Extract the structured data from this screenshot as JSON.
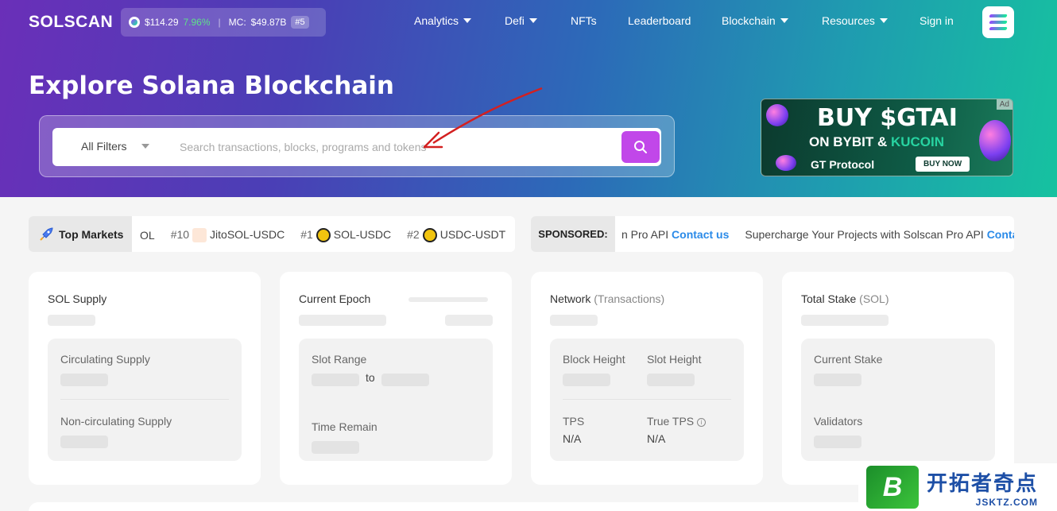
{
  "header": {
    "logo": "SOLSCAN",
    "price": "$114.29",
    "change": "7.96%",
    "mc_label": "MC:",
    "mc_value": "$49.87B",
    "rank": "#5",
    "nav": [
      {
        "label": "Analytics",
        "dropdown": true
      },
      {
        "label": "Defi",
        "dropdown": true
      },
      {
        "label": "NFTs",
        "dropdown": false
      },
      {
        "label": "Leaderboard",
        "dropdown": false
      },
      {
        "label": "Blockchain",
        "dropdown": true
      },
      {
        "label": "Resources",
        "dropdown": true
      },
      {
        "label": "Sign in",
        "dropdown": false
      }
    ]
  },
  "hero": {
    "title": "Explore Solana Blockchain",
    "filter_label": "All Filters",
    "search_placeholder": "Search transactions, blocks, programs and tokens"
  },
  "ad": {
    "line1": "BUY $GTAI",
    "line2a": "ON BYBIT &",
    "line2b": "KUCOIN",
    "line3": "GT Protocol",
    "cta": "BUY NOW",
    "tag": "Ad"
  },
  "ticker": {
    "title": "Top Markets",
    "items": [
      {
        "rank": "",
        "pair": "OL"
      },
      {
        "rank": "#10",
        "pair": "JitoSOL-USDC"
      },
      {
        "rank": "#1",
        "pair": "SOL-USDC"
      },
      {
        "rank": "#2",
        "pair": "USDC-USDT"
      }
    ]
  },
  "sponsored": {
    "title": "SPONSORED:",
    "fragment": "n Pro API",
    "contact": "Contact us",
    "message": "Supercharge Your Projects with Solscan Pro API",
    "contact_cut": "Conta"
  },
  "cards": {
    "supply": {
      "title": "SOL Supply",
      "circ": "Circulating Supply",
      "noncirc": "Non-circulating Supply"
    },
    "epoch": {
      "title": "Current Epoch",
      "slot_range": "Slot Range",
      "to": "to",
      "time_remain": "Time Remain"
    },
    "network": {
      "title": "Network",
      "title_sub": "(Transactions)",
      "block_height": "Block Height",
      "slot_height": "Slot Height",
      "tps": "TPS",
      "tps_val": "N/A",
      "true_tps": "True TPS",
      "true_tps_val": "N/A"
    },
    "stake": {
      "title": "Total Stake",
      "title_sub": "(SOL)",
      "current": "Current Stake",
      "validators": "Validators"
    }
  },
  "corner": {
    "logo": "B",
    "cn": "开拓者奇点",
    "url": "JSKTZ.COM"
  },
  "colors": {
    "accent": "#c147e9",
    "link": "#2a8ae8"
  }
}
